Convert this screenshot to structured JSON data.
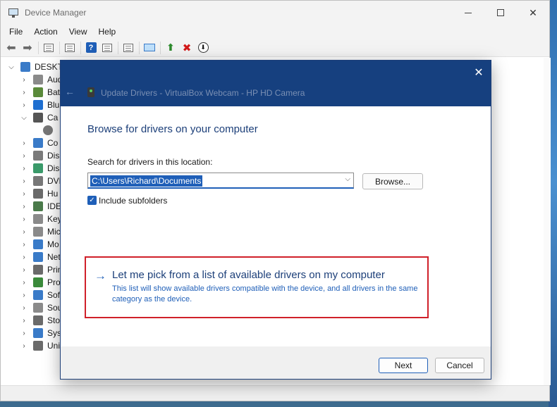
{
  "window": {
    "title": "Device Manager",
    "minimize_icon": "minimize-icon",
    "maximize_icon": "maximize-icon",
    "close_glyph": "✕"
  },
  "menu": [
    "File",
    "Action",
    "View",
    "Help"
  ],
  "toolbar": {
    "icons": [
      "back-arrow-icon",
      "forward-arrow-icon",
      "properties-icon",
      "list-icon",
      "help-icon",
      "action-pane-icon",
      "print-icon",
      "scan-hardware-icon",
      "update-driver-icon",
      "uninstall-icon",
      "disable-device-icon"
    ]
  },
  "tree": {
    "root": "DESKTO",
    "items": [
      {
        "label": "Aud",
        "expanded": false,
        "color": "#8a8a8a"
      },
      {
        "label": "Bat",
        "expanded": false,
        "color": "#5a8a3a"
      },
      {
        "label": "Blu",
        "expanded": false,
        "color": "#1f6fd0"
      },
      {
        "label": "Ca",
        "expanded": true,
        "color": "#555555"
      },
      {
        "label": "Co",
        "expanded": false,
        "color": "#3a7bc8"
      },
      {
        "label": "Dis",
        "expanded": false,
        "color": "#7a7a7a"
      },
      {
        "label": "Disp",
        "expanded": false,
        "color": "#3a9a6a"
      },
      {
        "label": "DVD",
        "expanded": false,
        "color": "#777777"
      },
      {
        "label": "Hu",
        "expanded": false,
        "color": "#6a6a6a"
      },
      {
        "label": "IDE",
        "expanded": false,
        "color": "#4a7a4a"
      },
      {
        "label": "Key",
        "expanded": false,
        "color": "#8a8a8a"
      },
      {
        "label": "Mic",
        "expanded": false,
        "color": "#8a8a8a"
      },
      {
        "label": "Mo",
        "expanded": false,
        "color": "#3a7bc8"
      },
      {
        "label": "Net",
        "expanded": false,
        "color": "#3a7bc8"
      },
      {
        "label": "Prin",
        "expanded": false,
        "color": "#6a6a6a"
      },
      {
        "label": "Pro",
        "expanded": false,
        "color": "#3a8a3a"
      },
      {
        "label": "Soft",
        "expanded": false,
        "color": "#3a7bc8"
      },
      {
        "label": "Sou",
        "expanded": false,
        "color": "#8a8a8a"
      },
      {
        "label": "Sto",
        "expanded": false,
        "color": "#6a6a6a"
      },
      {
        "label": "Sys",
        "expanded": false,
        "color": "#3a7bc8"
      },
      {
        "label": "Uni",
        "expanded": false,
        "color": "#6a6a6a"
      }
    ]
  },
  "dialog": {
    "title": "Update Drivers - VirtualBox Webcam - HP HD Camera",
    "close_glyph": "✕",
    "back_glyph": "←",
    "heading": "Browse for drivers on your computer",
    "search_label": "Search for drivers in this location:",
    "path_value": "C:\\Users\\Richard\\Documents",
    "browse_label": "Browse...",
    "include_subfolders_label": "Include subfolders",
    "include_subfolders_checked": true,
    "pick_option": {
      "arrow": "→",
      "title": "Let me pick from a list of available drivers on my computer",
      "description": "This list will show available drivers compatible with the device, and all drivers in the same category as the device."
    },
    "next_label": "Next",
    "cancel_label": "Cancel"
  },
  "colors": {
    "accent": "#1f5fb8",
    "dialog_header": "#16407f",
    "highlight_box": "#d0202a"
  }
}
